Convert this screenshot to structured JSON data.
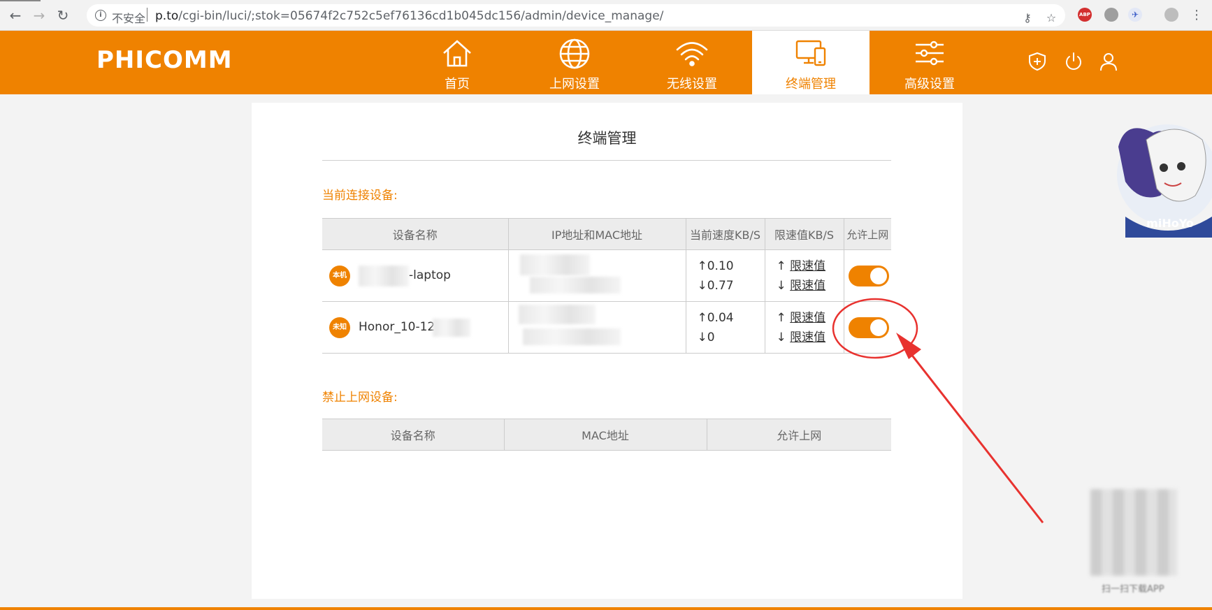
{
  "browser": {
    "security_label": "不安全",
    "url_host": "p.to",
    "url_path": "/cgi-bin/luci/;stok=05674f2c752c5ef76136cd1b045dc156/admin/device_manage/",
    "ext_abp": "ABP"
  },
  "router": {
    "brand": "PHICOMM",
    "nav": [
      {
        "label": "首页",
        "icon": "home-icon"
      },
      {
        "label": "上网设置",
        "icon": "globe-icon"
      },
      {
        "label": "无线设置",
        "icon": "wifi-icon"
      },
      {
        "label": "终端管理",
        "icon": "devices-icon",
        "active": true
      },
      {
        "label": "高级设置",
        "icon": "sliders-icon"
      }
    ]
  },
  "page": {
    "title": "终端管理",
    "connected_label": "当前连接设备:",
    "blocked_label": "禁止上网设备:"
  },
  "connected_table": {
    "headers": [
      "设备名称",
      "IP地址和MAC地址",
      "当前速度KB/S",
      "限速值KB/S",
      "允许上网"
    ],
    "rows": [
      {
        "badge": "本机",
        "name": "-laptop",
        "up_speed": "↑0.10",
        "down_speed": "↓0.77",
        "up_limit_arrow": "↑",
        "down_limit_arrow": "↓",
        "limit_link": "限速值",
        "allowed": true
      },
      {
        "badge": "未知",
        "name": "Honor_10-12c",
        "up_speed": "↑0.04",
        "down_speed": "↓0",
        "up_limit_arrow": "↑",
        "down_limit_arrow": "↓",
        "limit_link": "限速值",
        "allowed": true
      }
    ]
  },
  "blocked_table": {
    "headers": [
      "设备名称",
      "MAC地址",
      "允许上网"
    ]
  },
  "sidebar": {
    "mascot_brand": "miHoYo",
    "qr_caption": "扫一扫下载APP"
  },
  "colors": {
    "brand": "#ef8200",
    "annotation": "#e8322f"
  }
}
